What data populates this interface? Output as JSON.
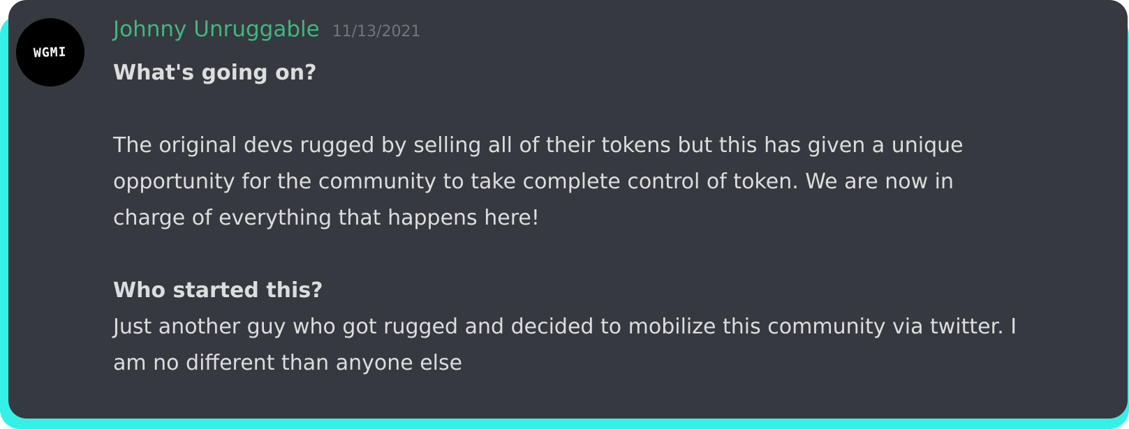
{
  "message": {
    "avatar_text": "WGMI",
    "username": "Johnny Unruggable",
    "timestamp": "11/13/2021",
    "heading_1": "What's going on?",
    "paragraph_1": "The original devs rugged by selling all of their tokens but this has given a unique\nopportunity for the community to take complete control of token. We are now in\ncharge of everything that happens here!",
    "heading_2": "Who started this?",
    "paragraph_2": "Just another guy who got rugged and decided to mobilize this community via twitter. I\nam no different than anyone else"
  },
  "colors": {
    "card_background": "#36393f",
    "accent_border": "#35f0e6",
    "username": "#43b581",
    "timestamp": "#72767d",
    "body_text": "#dcddde",
    "avatar_background": "#000000"
  }
}
